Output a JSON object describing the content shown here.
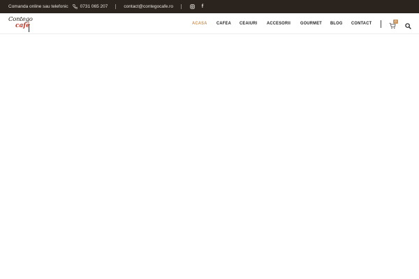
{
  "topbar": {
    "order_text": "Comanda online sau telefonic",
    "phone": "0731 065 207",
    "email": "contact@contegocafe.ro",
    "icons": [
      "phone-icon",
      "instagram-icon",
      "facebook-icon"
    ],
    "facebook_glyph": "f"
  },
  "logo": {
    "line1": "Contego",
    "line2": "café"
  },
  "nav": {
    "items": [
      {
        "label": "ACASA",
        "active": true
      },
      {
        "label": "CAFEA",
        "active": false
      },
      {
        "label": "CEAIURI",
        "active": false
      },
      {
        "label": "ACCESORII",
        "active": false
      },
      {
        "label": "GOURMET",
        "active": false
      },
      {
        "label": "BLOG",
        "active": false
      },
      {
        "label": "CONTACT",
        "active": false
      }
    ]
  },
  "cart": {
    "count": "0",
    "icon": "cart-icon"
  },
  "search": {
    "icon": "search-icon"
  },
  "colors": {
    "topbar_bg": "#2b231d",
    "accent": "#c8955e",
    "logo_red": "#c0392b"
  }
}
